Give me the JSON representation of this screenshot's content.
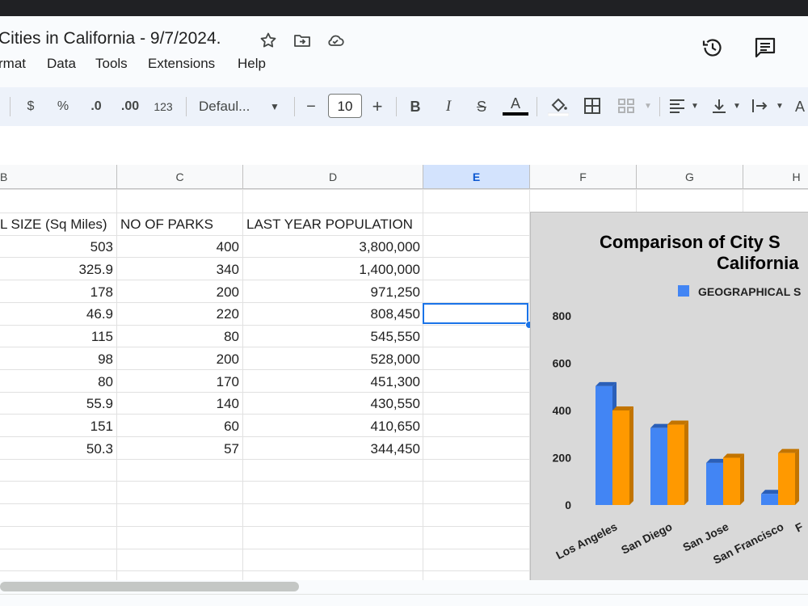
{
  "doc": {
    "title": "Cities in California - 9/7/2024."
  },
  "menu": [
    "rmat",
    "Data",
    "Tools",
    "Extensions",
    "Help"
  ],
  "toolbar": {
    "currency": "$",
    "percent": "%",
    "dec_decrease": ".0",
    "dec_increase": ".00",
    "number_format": "123",
    "font": "Defaul...",
    "font_size": "10",
    "minus": "−",
    "plus": "+",
    "bold": "B",
    "italic": "I",
    "strike": "S",
    "text_color": "A"
  },
  "columns": [
    "B",
    "C",
    "D",
    "E",
    "F",
    "G",
    "H"
  ],
  "selected_column": "E",
  "headers": {
    "b": "L SIZE (Sq Miles)",
    "c": "NO OF PARKS",
    "d": "LAST YEAR POPULATION"
  },
  "rows": [
    {
      "b": "503",
      "c": "400",
      "d": "3,800,000"
    },
    {
      "b": "325.9",
      "c": "340",
      "d": "1,400,000"
    },
    {
      "b": "178",
      "c": "200",
      "d": "971,250"
    },
    {
      "b": "46.9",
      "c": "220",
      "d": "808,450"
    },
    {
      "b": "115",
      "c": "80",
      "d": "545,550"
    },
    {
      "b": "98",
      "c": "200",
      "d": "528,000"
    },
    {
      "b": "80",
      "c": "170",
      "d": "451,300"
    },
    {
      "b": "55.9",
      "c": "140",
      "d": "430,550"
    },
    {
      "b": "151",
      "c": "60",
      "d": "410,650"
    },
    {
      "b": "50.3",
      "c": "57",
      "d": "344,450"
    }
  ],
  "chart_data": {
    "type": "bar",
    "title_line1": "Comparison of City S",
    "title_line2": "California",
    "legend": "GEOGRAPHICAL S",
    "legend_color": "#4285f4",
    "series_colors": [
      "#4285f4",
      "#ff9900"
    ],
    "y_ticks": [
      "0",
      "200",
      "400",
      "600",
      "800"
    ],
    "ylim": [
      0,
      800
    ],
    "categories": [
      "Los Angeles",
      "San Diego",
      "San Jose",
      "San Francisco",
      "F"
    ],
    "series": [
      {
        "values": [
          503,
          325.9,
          178,
          46.9
        ]
      },
      {
        "values": [
          400,
          340,
          200,
          220
        ]
      }
    ]
  }
}
